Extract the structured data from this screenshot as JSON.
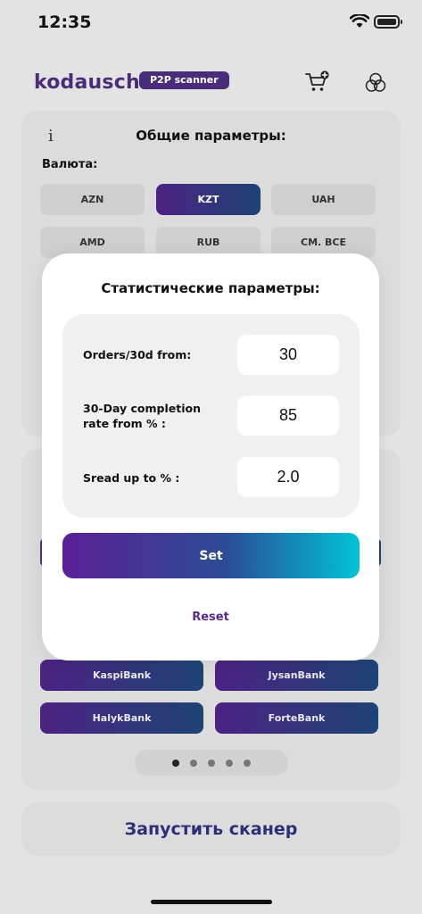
{
  "status": {
    "time": "12:35"
  },
  "header": {
    "brand": "kodausch",
    "badge": "P2P scanner"
  },
  "general": {
    "title": "Общие параметры:",
    "info": "i",
    "currency_label": "Валюта:",
    "currencies": [
      {
        "label": "AZN",
        "selected": false
      },
      {
        "label": "KZT",
        "selected": true
      },
      {
        "label": "UAH",
        "selected": false
      },
      {
        "label": "AMD",
        "selected": false
      },
      {
        "label": "RUB",
        "selected": false
      },
      {
        "label": "СМ. ВСЕ",
        "selected": false
      }
    ]
  },
  "banks": [
    {
      "label": "KaspiBank"
    },
    {
      "label": "JysanBank"
    },
    {
      "label": "HalykBank"
    },
    {
      "label": "ForteBank"
    }
  ],
  "pagination": {
    "count": 5,
    "active": 0
  },
  "start_button": "Запустить сканер",
  "modal": {
    "title": "Статистические параметры:",
    "fields": [
      {
        "label": "Orders/30d from:",
        "value": "30"
      },
      {
        "label": "30-Day completion rate from % :",
        "value": "85"
      },
      {
        "label": "Sread up to % :",
        "value": "2.0"
      }
    ],
    "set_label": "Set",
    "reset_label": "Reset"
  },
  "colors": {
    "brand": "#4a2d7a",
    "gradient_start": "#5b1f96",
    "gradient_end": "#00c3d6",
    "reset": "#5b2a8e"
  },
  "icons": [
    "wifi-icon",
    "battery-icon",
    "cart-add-icon",
    "coins-icon",
    "info-icon"
  ]
}
